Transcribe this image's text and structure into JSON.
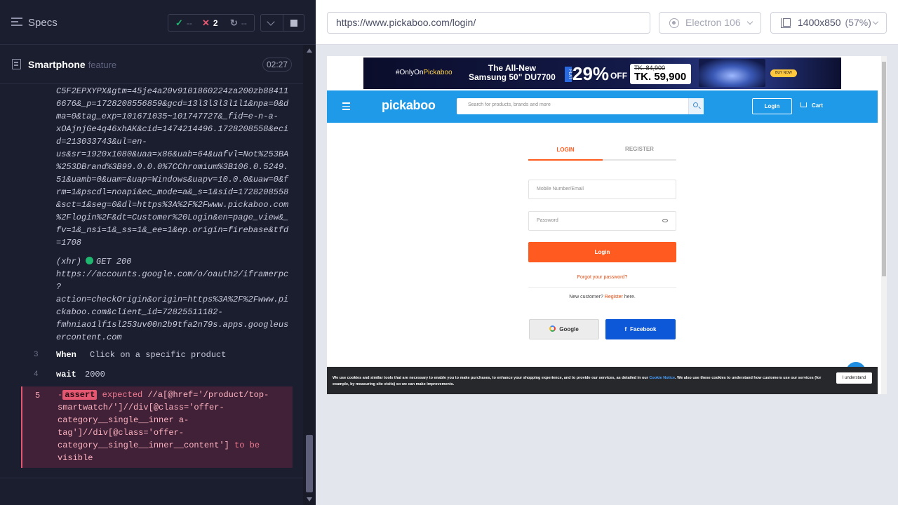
{
  "reporter": {
    "specs_label": "Specs",
    "stats": {
      "passed": "--",
      "failed": "2",
      "pending": "--"
    },
    "spec": {
      "name": "Smartphone",
      "ext": "feature",
      "time": "02:27"
    },
    "log": {
      "url_lines": [
        "C5F2EPXYPX&gtm=45je4a20v9101860224za200zb88411",
        "6676&_p=1728208556859&gcd=13l3l3l3l1l1&npa=0&d",
        "ma=0&tag_exp=101671035~101747727&_fid=e-n-a-",
        "xOAjnjGe4q46xhAK&cid=1474214496.1728208558&eci",
        "d=213033743&ul=en-",
        "us&sr=1920x1080&uaa=x86&uab=64&uafvl=Not%253BA",
        "%253DBrand%3B99.0.0.0%7CChromium%3B106.0.5249.",
        "51&uamb=0&uam=&uap=Windows&uapv=10.0.0&uaw=0&f",
        "rm=1&pscdl=noapi&ec_mode=a&_s=1&sid=1728208558",
        "&sct=1&seg=0&dl=https%3A%2F%2Fwww.pickaboo.com",
        "%2Flogin%2F&dt=Customer%20Login&en=page_view&_",
        "fv=1&_nsi=1&_ss=1&_ee=1&ep.origin=firebase&tfd",
        "=1708"
      ],
      "xhr_label": "(xhr)",
      "xhr_status": "GET 200",
      "xhr_url_lines": [
        "https://accounts.google.com/o/oauth2/iframerpc",
        "?",
        "action=checkOrigin&origin=https%3A%2F%2Fwww.pi",
        "ckaboo.com&client_id=72825511182-",
        "fmhniao1lf1sl253uv00n2b9tfa2n79s.apps.googleus",
        "ercontent.com"
      ],
      "commands": [
        {
          "num": "3",
          "name": "When",
          "msg": "Click on a specific product"
        },
        {
          "num": "4",
          "name": "wait",
          "msg": "2000"
        }
      ],
      "failure": {
        "num": "5",
        "dash": "-",
        "badge": "assert",
        "expected": "expected",
        "selector_lines": [
          "//a[@href='/product/top-",
          "smartwatch/']//div[@class='offer-",
          "category__single__inner a-",
          "tag']//div[@class='offer-",
          "category__single__inner__content']"
        ],
        "to_be": "to be",
        "visible": "visible"
      }
    }
  },
  "browser": {
    "url": "https://www.pickaboo.com/login/",
    "engine": "Electron 106",
    "viewport": "1400x850",
    "scale": "(57%)"
  },
  "aut": {
    "promo": {
      "only_on": "#OnlyOn",
      "brand": "Pickaboo",
      "title_line1": "The All-New",
      "title_line2": "Samsung 50\" DU7700",
      "flat": "FLAT",
      "discount": "29%",
      "off": "OFF",
      "old_price": "TK. 84,900",
      "new_price": "TK. 59,900",
      "buy": "BUY NOW"
    },
    "nav": {
      "logo": "pickaboo",
      "search_placeholder": "Search for products, brands and more",
      "login": "Login",
      "cart": "Cart"
    },
    "tabs": {
      "login": "LOGIN",
      "register": "REGISTER"
    },
    "form": {
      "mobile_placeholder": "Mobile Number/Email",
      "password_placeholder": "Password",
      "login_button": "Login",
      "forgot": "Forgot your password?",
      "new_customer": "New customer?",
      "register_link": "Register",
      "here": "here.",
      "google": "Google",
      "facebook": "Facebook"
    },
    "cookie": {
      "text_before": "We use cookies and similar tools that are necessary to enable you to make purchases, to enhance your shopping experience, and to provide our services, as detailed in our",
      "link": "Cookie Notice",
      "text_after": ". We also use these cookies to understand how customers use our services (for example, by measuring site visits) so we can make improvements.",
      "button": "I understand"
    }
  },
  "colors": {
    "reporter_bg": "#1b1e2e",
    "pass": "#1fb66f",
    "fail": "#e45770",
    "brand_blue": "#1f9ae8",
    "accent_orange": "#ff5a1f",
    "facebook_blue": "#0d58d8"
  }
}
